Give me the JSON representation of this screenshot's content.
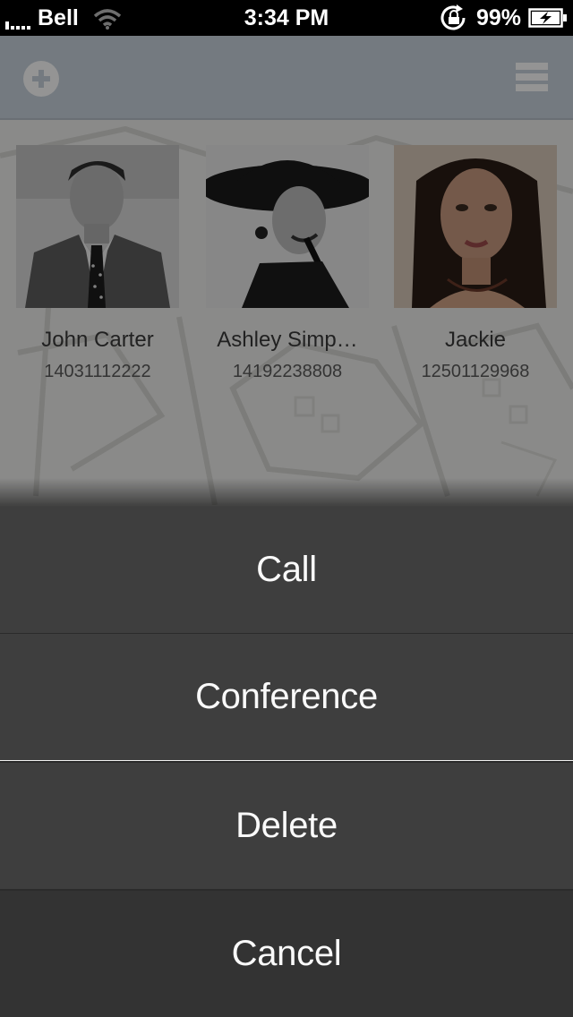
{
  "status_bar": {
    "carrier": "Bell",
    "time": "3:34 PM",
    "battery_percent": "99%",
    "signal_icon": "signal-bars-icon",
    "wifi_icon": "wifi-icon",
    "rotation_lock_icon": "rotation-lock-icon",
    "battery_icon": "battery-charging-icon"
  },
  "nav_bar": {
    "add_icon": "plus-circle-icon",
    "menu_icon": "hamburger-menu-icon",
    "background_color": "#c8d2dc"
  },
  "contacts": [
    {
      "name": "John Carter",
      "number": "14031112222",
      "avatar": "photo-man-in-suit"
    },
    {
      "name": "Ashley Simp…",
      "number": "14192238808",
      "avatar": "photo-woman-with-hat"
    },
    {
      "name": "Jackie",
      "number": "12501129968",
      "avatar": "photo-woman-portrait"
    }
  ],
  "action_sheet": {
    "buttons": [
      {
        "label": "Call"
      },
      {
        "label": "Conference"
      },
      {
        "label": "Delete"
      },
      {
        "label": "Cancel"
      }
    ],
    "button_color": "#3e3e3e",
    "cancel_color": "#333333",
    "text_color": "#fafafa"
  }
}
